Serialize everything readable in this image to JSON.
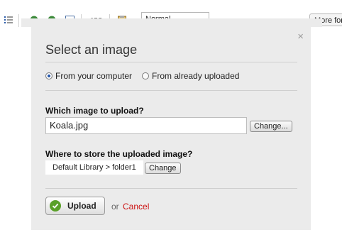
{
  "toolbar": {
    "icons": [
      "list-icon",
      "globe-icon",
      "globe-link-icon",
      "image-icon",
      "spellcheck-icon",
      "paste-icon"
    ],
    "format_select_value": "Normal",
    "more_button_label": "More for"
  },
  "dialog": {
    "title": "Select an image",
    "close_symbol": "×",
    "source_options": [
      {
        "label": "From your computer",
        "selected": true
      },
      {
        "label": "From already uploaded",
        "selected": false
      }
    ],
    "upload_question": "Which image to upload?",
    "file_value": "Koala.jpg",
    "change_file_label": "Change...",
    "store_question": "Where to store the uploaded image?",
    "library_path": "Default Library > folder1",
    "change_location_label": "Change",
    "upload_label": "Upload",
    "or_text": "or",
    "cancel_label": "Cancel"
  },
  "colors": {
    "dialog_bg": "#ebebeb",
    "cancel": "#cc1111",
    "check": "#5aa028"
  }
}
